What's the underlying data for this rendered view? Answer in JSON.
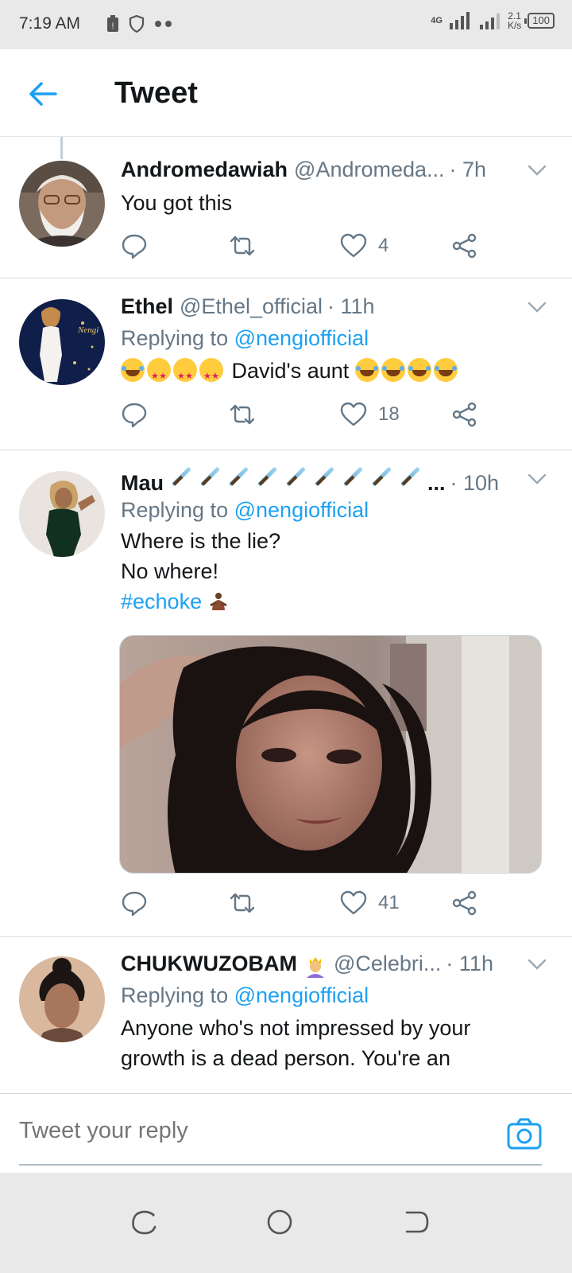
{
  "status_bar": {
    "time": "7:19 AM",
    "network": "4G",
    "speed_value": "2.1",
    "speed_unit": "K/s",
    "battery": "100"
  },
  "header": {
    "title": "Tweet"
  },
  "tweets": [
    {
      "name": "Andromedawiah",
      "handle": "@Andromeda...",
      "time": "· 7h",
      "text": "You got this",
      "likes": "4"
    },
    {
      "name": "Ethel",
      "handle": "@Ethel_official",
      "time": "· 11h",
      "replying_prefix": "Replying to",
      "replying_to": "@nengiofficial",
      "text": "David's aunt",
      "likes": "18"
    },
    {
      "name": "Mau",
      "name_suffix": "...",
      "time": "· 10h",
      "replying_prefix": "Replying to",
      "replying_to": "@nengiofficial",
      "text_line1": "Where is the lie?",
      "text_line2": "No where!",
      "hashtag": "#echoke",
      "likes": "41"
    },
    {
      "name": "CHUKWUZOBAM",
      "handle": "@Celebri...",
      "time": "· 11h",
      "replying_prefix": "Replying to",
      "replying_to": "@nengiofficial",
      "text_line1": "Anyone who's not impressed by your",
      "text_line2": "growth is a dead person. You're an"
    }
  ],
  "reply_bar": {
    "placeholder": "Tweet your reply"
  },
  "icons": {
    "back": "arrow-left-icon",
    "reply": "reply-icon",
    "retweet": "retweet-icon",
    "like": "heart-icon",
    "share": "share-icon",
    "chevron": "chevron-down-icon",
    "camera": "camera-icon"
  },
  "colors": {
    "accent": "#1da1f2",
    "secondary_text": "#657786"
  }
}
